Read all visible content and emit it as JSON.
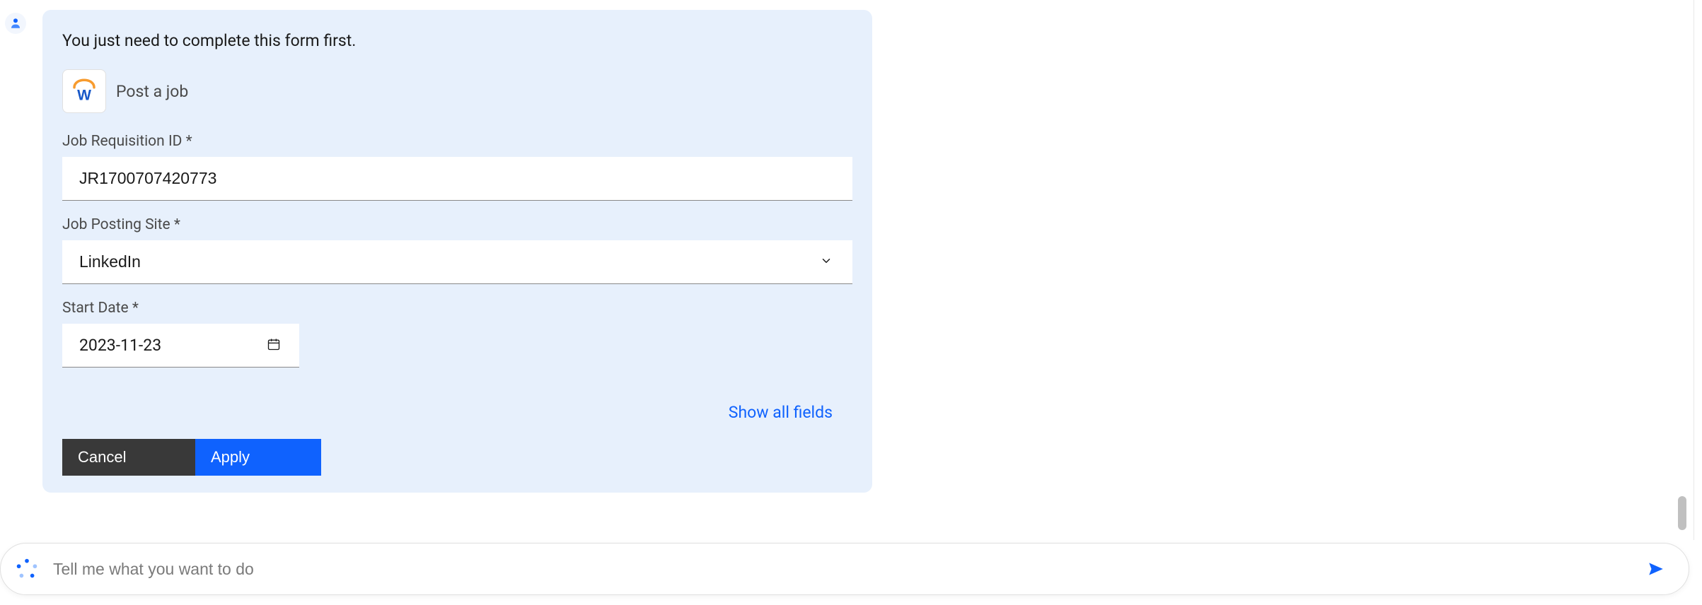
{
  "message": {
    "intro": "You just need to complete this form first.",
    "action_title": "Post a job"
  },
  "form": {
    "job_req_label": "Job Requisition ID *",
    "job_req_value": "JR1700707420773",
    "posting_site_label": "Job Posting Site *",
    "posting_site_value": "LinkedIn",
    "start_date_label": "Start Date *",
    "start_date_value": "2023-11-23",
    "show_all_label": "Show all fields",
    "cancel_label": "Cancel",
    "apply_label": "Apply"
  },
  "composer": {
    "placeholder": "Tell me what you want to do"
  }
}
